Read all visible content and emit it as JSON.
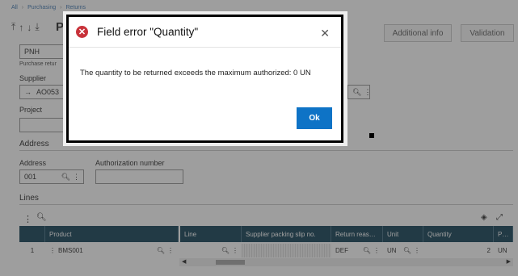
{
  "breadcrumb": {
    "items": [
      "All",
      "Purchasing",
      "Returns"
    ]
  },
  "toolbar": {
    "icons": [
      "first-icon",
      "up-icon",
      "down-icon",
      "last-icon"
    ],
    "title_letter": "P"
  },
  "top_buttons": {
    "additional_info": "Additional info",
    "validation": "Validation"
  },
  "form": {
    "site_value": "PNH",
    "purchase_return_label": "Purchase retur",
    "supplier_label": "Supplier",
    "supplier_value": "AO053",
    "project_label": "Project",
    "address_section": "Address",
    "address_label": "Address",
    "address_value": "001",
    "authorization_label": "Authorization number"
  },
  "lines": {
    "section_title": "Lines",
    "columns": [
      "Product",
      "Line",
      "Supplier packing slip no.",
      "Return reas…",
      "Unit",
      "Quantity",
      "P…"
    ],
    "rows": [
      {
        "num": "1",
        "product": "BMS001",
        "line": "",
        "slip": "",
        "reason": "DEF",
        "unit": "UN",
        "quantity": "2",
        "p": "UN"
      }
    ]
  },
  "dialog": {
    "title": "Field error \"Quantity\"",
    "message": "The quantity to be returned exceeds the maximum authorized: 0 UN",
    "ok_label": "Ok",
    "colors": {
      "error": "#c8323a",
      "primary": "#0e73c6"
    }
  }
}
